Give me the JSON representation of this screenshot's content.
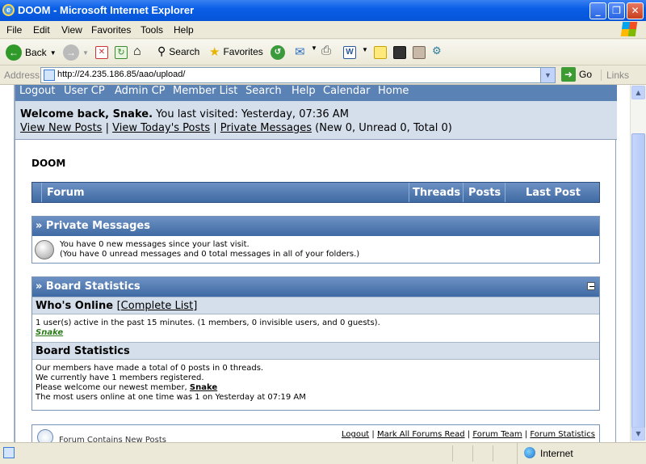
{
  "window": {
    "title": "DOOM - Microsoft Internet Explorer"
  },
  "menu": [
    "File",
    "Edit",
    "View",
    "Favorites",
    "Tools",
    "Help"
  ],
  "toolbar": {
    "back": "Back",
    "search": "Search",
    "favorites": "Favorites"
  },
  "address": {
    "label": "Address",
    "url": "http://24.235.186.85/aao/upload/",
    "go": "Go",
    "links": "Links"
  },
  "nav": [
    "Logout",
    "User CP",
    "Admin CP",
    "Member List",
    "Search",
    "Help",
    "Calendar",
    "Home"
  ],
  "welcome": {
    "greeting": "Welcome back, Snake.",
    "last_visit": "You last visited: Yesterday, 07:36 AM",
    "link_new": "View New Posts",
    "link_today": "View Today's Posts",
    "link_pm": "Private Messages",
    "pm_counts": "(New 0, Unread 0, Total 0)"
  },
  "forum": {
    "title": "DOOM",
    "col_forum": "Forum",
    "col_threads": "Threads",
    "col_posts": "Posts",
    "col_last": "Last Post"
  },
  "pm": {
    "header": "» Private Messages",
    "line1": "You have 0 new messages since your last visit.",
    "line2": "(You have 0 unread messages and 0 total messages in all of your folders.)"
  },
  "stats": {
    "header": "» Board Statistics",
    "online_title": "Who's Online",
    "complete_list": "Complete List",
    "online_line": "1 user(s) active in the past 15 minutes. (1 members, 0 invisible users, and 0 guests).",
    "online_user": "Snake",
    "board_title": "Board Statistics",
    "b1": "Our members have made a total of 0 posts in 0 threads.",
    "b2": "We currently have 1 members registered.",
    "b3_prefix": "Please welcome our newest member,",
    "b3_user": "Snake",
    "b4": "The most users online at one time was 1 on Yesterday at 07:19 AM"
  },
  "footer": {
    "legend": "Forum Contains New Posts",
    "links": [
      "Logout",
      "Mark All Forums Read",
      "Forum Team",
      "Forum Statistics"
    ]
  },
  "status": {
    "zone": "Internet"
  }
}
